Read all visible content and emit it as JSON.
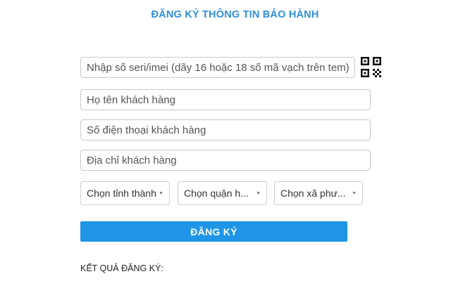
{
  "form": {
    "title": "ĐĂNG KÝ THÔNG TIN BẢO HÀNH",
    "serial_placeholder": "Nhập số seri/imei (dãy 16 hoặc 18 số mã vạch trên tem)",
    "name_placeholder": "Họ tên khách hàng",
    "phone_placeholder": "Số điện thoại khách hàng",
    "address_placeholder": "Địa chỉ khách hàng",
    "province_select": "Chọn tỉnh thành",
    "district_select": "Chọn quận h...",
    "ward_select": "Chọn xã phư...",
    "submit_label": "ĐĂNG KÝ",
    "result_label": "KẾT QUẢ ĐĂNG KÝ:"
  },
  "icons": {
    "qr": "qr-code-icon",
    "caret": "caret-down-icon"
  },
  "colors": {
    "title": "#2f8fdc",
    "button": "#1e95e6"
  }
}
